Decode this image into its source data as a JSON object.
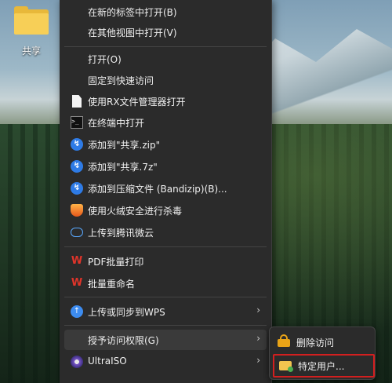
{
  "desktop": {
    "folder_label": "共享"
  },
  "menu": {
    "items": [
      {
        "label": "在新的标签中打开(B)",
        "icon": "none"
      },
      {
        "label": "在其他视图中打开(V)",
        "icon": "none"
      },
      {
        "label": "打开(O)",
        "icon": "none"
      },
      {
        "label": "固定到快速访问",
        "icon": "none"
      },
      {
        "label": "使用RX文件管理器打开",
        "icon": "document-icon"
      },
      {
        "label": "在终端中打开",
        "icon": "terminal-icon"
      },
      {
        "label": "添加到\"共享.zip\"",
        "icon": "bandizip-icon"
      },
      {
        "label": "添加到\"共享.7z\"",
        "icon": "bandizip-icon"
      },
      {
        "label": "添加到压缩文件 (Bandizip)(B)...",
        "icon": "bandizip-icon"
      },
      {
        "label": "使用火绒安全进行杀毒",
        "icon": "huorong-shield-icon"
      },
      {
        "label": "上传到腾讯微云",
        "icon": "cloud-icon"
      },
      {
        "label": "PDF批量打印",
        "icon": "wps-pdf-icon"
      },
      {
        "label": "批量重命名",
        "icon": "wps-rename-icon"
      },
      {
        "label": "上传或同步到WPS",
        "icon": "wps-upload-icon"
      },
      {
        "label": "授予访问权限(G)",
        "icon": "none"
      },
      {
        "label": "UltraISO",
        "icon": "ultraiso-icon"
      }
    ],
    "submenu_arrow": "›"
  },
  "submenu": {
    "items": [
      {
        "label": "删除访问",
        "icon": "lock-icon"
      },
      {
        "label": "特定用户...",
        "icon": "folder-user-icon"
      }
    ]
  },
  "colors": {
    "menu_bg": "#2b2b2b",
    "highlight_border": "#d21f1f"
  }
}
